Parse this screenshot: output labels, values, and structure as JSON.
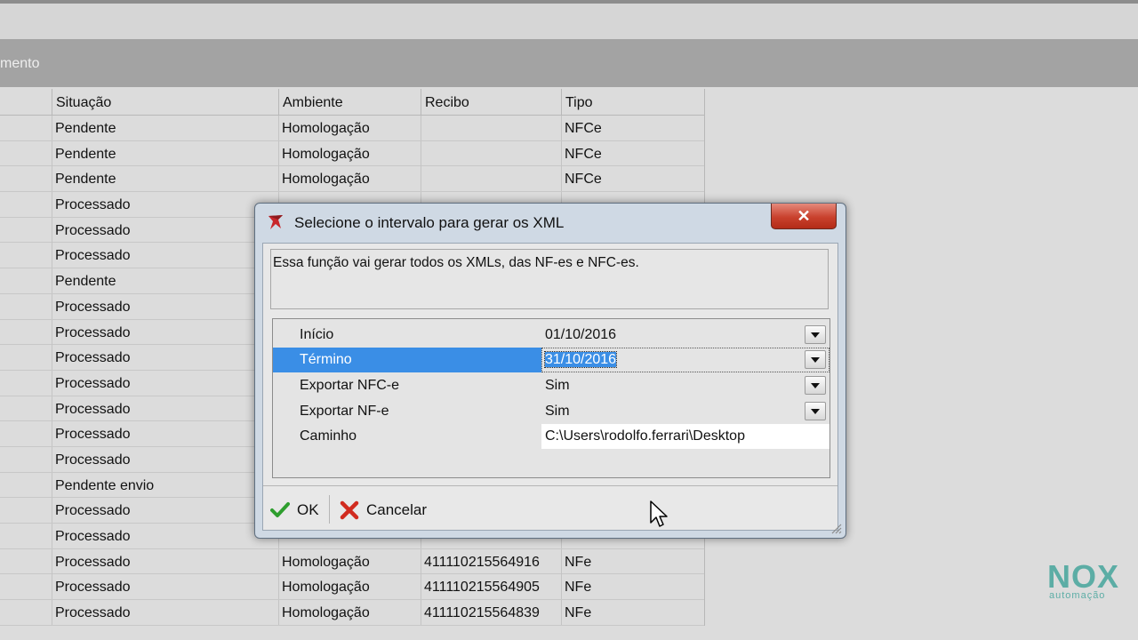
{
  "window": {
    "band_text": "mento"
  },
  "grid": {
    "columns": [
      "",
      "Situação",
      "Ambiente",
      "Recibo",
      "Tipo"
    ],
    "rows": [
      [
        "",
        "Pendente",
        "Homologação",
        "",
        "NFCe"
      ],
      [
        "",
        "Pendente",
        "Homologação",
        "",
        "NFCe"
      ],
      [
        "",
        "Pendente",
        "Homologação",
        "",
        "NFCe"
      ],
      [
        "",
        "Processado",
        "",
        "",
        ""
      ],
      [
        "",
        "Processado",
        "",
        "",
        ""
      ],
      [
        "",
        "Processado",
        "",
        "",
        ""
      ],
      [
        "",
        "Pendente",
        "",
        "",
        ""
      ],
      [
        "",
        "Processado",
        "",
        "",
        ""
      ],
      [
        "",
        "Processado",
        "",
        "",
        ""
      ],
      [
        "",
        "Processado",
        "",
        "",
        ""
      ],
      [
        "",
        "Processado",
        "",
        "",
        ""
      ],
      [
        "",
        "Processado",
        "",
        "",
        ""
      ],
      [
        "",
        "Processado",
        "",
        "",
        ""
      ],
      [
        "",
        "Processado",
        "",
        "",
        ""
      ],
      [
        "",
        "Pendente envio",
        "",
        "",
        ""
      ],
      [
        "",
        "Processado",
        "",
        "",
        ""
      ],
      [
        "",
        "Processado",
        "",
        "",
        ""
      ],
      [
        "",
        "Processado",
        "Homologação",
        "411110215564916",
        "NFe"
      ],
      [
        "",
        "Processado",
        "Homologação",
        "411110215564905",
        "NFe"
      ],
      [
        "",
        "Processado",
        "Homologação",
        "411110215564839",
        "NFe"
      ]
    ]
  },
  "dialog": {
    "title": "Selecione o intervalo para gerar os XML",
    "close_label": "✕",
    "description": "Essa função vai gerar todos os XMLs, das NF-es e NFC-es.",
    "properties": [
      {
        "label": "Início",
        "value": "01/10/2016",
        "dropdown": true
      },
      {
        "label": "Término",
        "value": "31/10/2016",
        "dropdown": true,
        "selected": true
      },
      {
        "label": "Exportar NFC-e",
        "value": "Sim",
        "dropdown": true
      },
      {
        "label": "Exportar NF-e",
        "value": "Sim",
        "dropdown": true
      },
      {
        "label": "Caminho",
        "value": "C:\\Users\\rodolfo.ferrari\\Desktop",
        "dropdown": false
      }
    ],
    "ok_label": "OK",
    "cancel_label": "Cancelar"
  },
  "watermark": {
    "brand": "NOX",
    "sub": "automação"
  },
  "colors": {
    "selection": "#3a8ee6",
    "ok_check": "#2e9e2e",
    "cancel_x": "#d12b1f",
    "close_button": "#c9412d"
  }
}
